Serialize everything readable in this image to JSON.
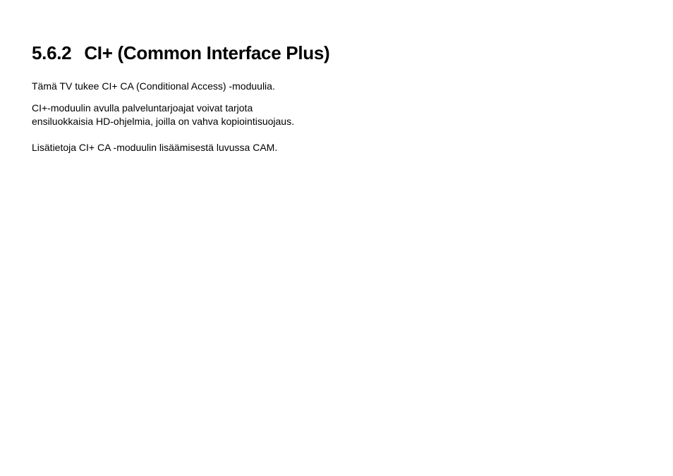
{
  "section": {
    "number": "5.6.2",
    "title": "CI+ (Common Interface Plus)",
    "paragraphs": [
      "Tämä TV tukee CI+ CA (Conditional Access) -moduulia.",
      "CI+-moduulin avulla palveluntarjoajat voivat tarjota ensiluokkaisia HD-ohjelmia, joilla on vahva kopiointisuojaus.",
      "Lisätietoja CI+ CA -moduulin lisäämisestä luvussa CAM."
    ]
  }
}
